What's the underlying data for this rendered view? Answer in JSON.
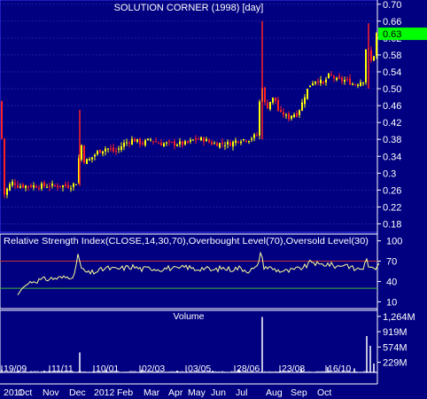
{
  "colors": {
    "background": "#000080",
    "up": "#ffff00",
    "down": "#ff2020",
    "volume": "#ffffff",
    "rsi_line": "#ffff99",
    "overbought": "#c83232",
    "oversold": "#3cb43c",
    "last_price_bg": "#00ff00",
    "axis_text": "#ffffff"
  },
  "chart_data": [
    {
      "panel": "price",
      "type": "candlestick",
      "title": "SOLUTION CORNER (1998) [day]",
      "ylim": [
        0.16,
        0.71
      ],
      "y_ticks": [
        "0.70",
        "0.66",
        "0.62",
        "0.58",
        "0.54",
        "0.50",
        "0.46",
        "0.42",
        "0.38",
        "0.34",
        "0.3",
        "0.26",
        "0.22",
        "0.18"
      ],
      "last_price": "0.63",
      "approx_close": [
        [
          0,
          0.47
        ],
        [
          5,
          0.25
        ],
        [
          10,
          0.27
        ],
        [
          15,
          0.28
        ],
        [
          20,
          0.27
        ],
        [
          30,
          0.27
        ],
        [
          40,
          0.27
        ],
        [
          50,
          0.27
        ],
        [
          60,
          0.27
        ],
        [
          70,
          0.27
        ],
        [
          80,
          0.27
        ],
        [
          88,
          0.28
        ],
        [
          90,
          0.39
        ],
        [
          95,
          0.33
        ],
        [
          100,
          0.33
        ],
        [
          110,
          0.35
        ],
        [
          120,
          0.36
        ],
        [
          130,
          0.35
        ],
        [
          140,
          0.37
        ],
        [
          150,
          0.38
        ],
        [
          160,
          0.37
        ],
        [
          170,
          0.38
        ],
        [
          180,
          0.37
        ],
        [
          190,
          0.37
        ],
        [
          200,
          0.37
        ],
        [
          210,
          0.37
        ],
        [
          220,
          0.38
        ],
        [
          230,
          0.38
        ],
        [
          240,
          0.37
        ],
        [
          250,
          0.37
        ],
        [
          260,
          0.37
        ],
        [
          270,
          0.38
        ],
        [
          280,
          0.38
        ],
        [
          290,
          0.39
        ],
        [
          295,
          0.52
        ],
        [
          300,
          0.45
        ],
        [
          305,
          0.47
        ],
        [
          310,
          0.48
        ],
        [
          315,
          0.44
        ],
        [
          320,
          0.44
        ],
        [
          325,
          0.43
        ],
        [
          330,
          0.44
        ],
        [
          335,
          0.44
        ],
        [
          340,
          0.46
        ],
        [
          345,
          0.49
        ],
        [
          350,
          0.51
        ],
        [
          355,
          0.52
        ],
        [
          360,
          0.52
        ],
        [
          365,
          0.51
        ],
        [
          370,
          0.53
        ],
        [
          375,
          0.53
        ],
        [
          380,
          0.52
        ],
        [
          390,
          0.52
        ],
        [
          400,
          0.51
        ],
        [
          410,
          0.52
        ],
        [
          414,
          0.62
        ],
        [
          418,
          0.56
        ],
        [
          422,
          0.58
        ],
        [
          425,
          0.63
        ]
      ]
    },
    {
      "panel": "rsi",
      "type": "line",
      "title": "Relative Strength Index(CLOSE,14,30,70),Overbought Level(70),Oversold Level(30)",
      "ylim": [
        0,
        110
      ],
      "y_ticks": [
        "100",
        "70",
        "40",
        "10"
      ],
      "overbought": 70,
      "oversold": 30,
      "approx_values": [
        [
          20,
          20
        ],
        [
          25,
          30
        ],
        [
          35,
          40
        ],
        [
          45,
          42
        ],
        [
          55,
          44
        ],
        [
          65,
          45
        ],
        [
          75,
          46
        ],
        [
          85,
          50
        ],
        [
          88,
          82
        ],
        [
          92,
          58
        ],
        [
          100,
          52
        ],
        [
          110,
          55
        ],
        [
          120,
          60
        ],
        [
          130,
          58
        ],
        [
          140,
          60
        ],
        [
          150,
          62
        ],
        [
          160,
          58
        ],
        [
          170,
          60
        ],
        [
          180,
          58
        ],
        [
          190,
          60
        ],
        [
          200,
          58
        ],
        [
          210,
          62
        ],
        [
          220,
          58
        ],
        [
          230,
          60
        ],
        [
          240,
          56
        ],
        [
          250,
          60
        ],
        [
          260,
          58
        ],
        [
          270,
          60
        ],
        [
          280,
          56
        ],
        [
          290,
          60
        ],
        [
          294,
          83
        ],
        [
          298,
          62
        ],
        [
          305,
          60
        ],
        [
          315,
          56
        ],
        [
          325,
          55
        ],
        [
          335,
          58
        ],
        [
          345,
          62
        ],
        [
          352,
          70
        ],
        [
          360,
          64
        ],
        [
          370,
          66
        ],
        [
          380,
          62
        ],
        [
          390,
          66
        ],
        [
          400,
          58
        ],
        [
          410,
          60
        ],
        [
          414,
          72
        ],
        [
          418,
          58
        ],
        [
          424,
          60
        ],
        [
          428,
          70
        ]
      ]
    },
    {
      "panel": "volume",
      "type": "bar",
      "title": "Volume",
      "ylim": [
        0,
        1400
      ],
      "y_ticks": [
        "1,264M",
        "919M",
        "574M",
        "229M"
      ],
      "approx_spikes_M": [
        [
          2,
          60
        ],
        [
          20,
          30
        ],
        [
          35,
          20
        ],
        [
          50,
          40
        ],
        [
          70,
          30
        ],
        [
          90,
          450
        ],
        [
          120,
          50
        ],
        [
          160,
          60
        ],
        [
          200,
          40
        ],
        [
          240,
          40
        ],
        [
          270,
          60
        ],
        [
          296,
          1250
        ],
        [
          340,
          80
        ],
        [
          370,
          120
        ],
        [
          400,
          90
        ],
        [
          414,
          820
        ],
        [
          418,
          600
        ],
        [
          422,
          200
        ]
      ]
    }
  ],
  "x_axis": {
    "date_ticks": [
      "19/09",
      "11/11",
      "10/01",
      "02/03",
      "03/05",
      "28/06",
      "23/08",
      "16/10"
    ],
    "month_labels": [
      "2011",
      "Oct",
      "Nov",
      "Dec",
      "2012",
      "Feb",
      "Mar",
      "Apr",
      "May",
      "Jun",
      "Jul",
      "Aug",
      "Sep",
      "Oct"
    ]
  }
}
